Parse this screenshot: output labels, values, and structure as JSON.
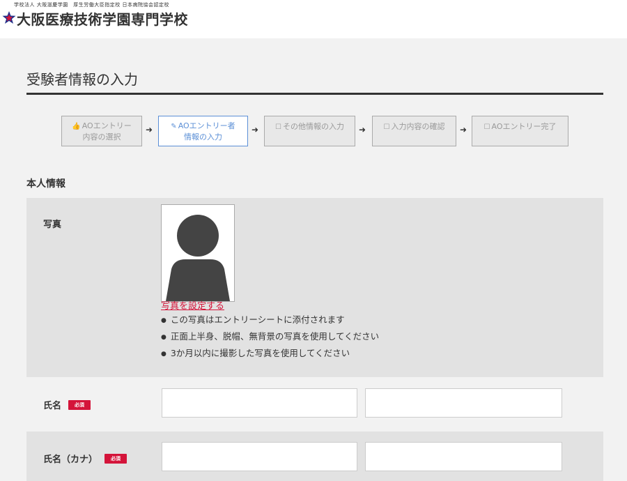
{
  "header": {
    "logo_small": "学校法人 大阪滋慶学園　厚生労働大臣指定校 日本病院協会認定校",
    "school_name": "大阪医療技術学園専門学校"
  },
  "page": {
    "title": "受験者情報の入力"
  },
  "steps": [
    {
      "icon": "thumb-icon",
      "glyph": "👍",
      "label": "AOエントリー内容の選択",
      "line1": "AOエントリー",
      "line2": "内容の選択",
      "state": "done"
    },
    {
      "icon": "edit-icon",
      "glyph": "✎",
      "label": "AOエントリー者情報の入力",
      "line1": "AOエントリー者",
      "line2": "情報の入力",
      "state": "active"
    },
    {
      "icon": "checkbox-icon",
      "glyph": "☐",
      "label": "その他情報の入力",
      "line1": "その他情報の入力",
      "line2": "",
      "state": "pending"
    },
    {
      "icon": "checkbox-icon",
      "glyph": "☐",
      "label": "入力内容の確認",
      "line1": "入力内容の確認",
      "line2": "",
      "state": "pending"
    },
    {
      "icon": "checkbox-icon",
      "glyph": "☐",
      "label": "AOエントリー完了",
      "line1": "AOエントリー完了",
      "line2": "",
      "state": "pending"
    }
  ],
  "section": {
    "title": "本人情報"
  },
  "photo_row": {
    "label": "写真",
    "link": "写真を設定する",
    "notes": [
      "この写真はエントリーシートに添付されます",
      "正面上半身、脱帽、無背景の写真を使用してください",
      "3か月以内に撮影した写真を使用してください"
    ]
  },
  "name_row": {
    "label": "氏名",
    "required": "必須",
    "last_name_value": "",
    "first_name_value": ""
  },
  "kana_row": {
    "label": "氏名（カナ）",
    "required": "必須",
    "last_name_value": "",
    "first_name_value": ""
  },
  "colors": {
    "required_badge": "#d4143a",
    "active_step": "#5b8fd6",
    "link": "#d4143a"
  }
}
